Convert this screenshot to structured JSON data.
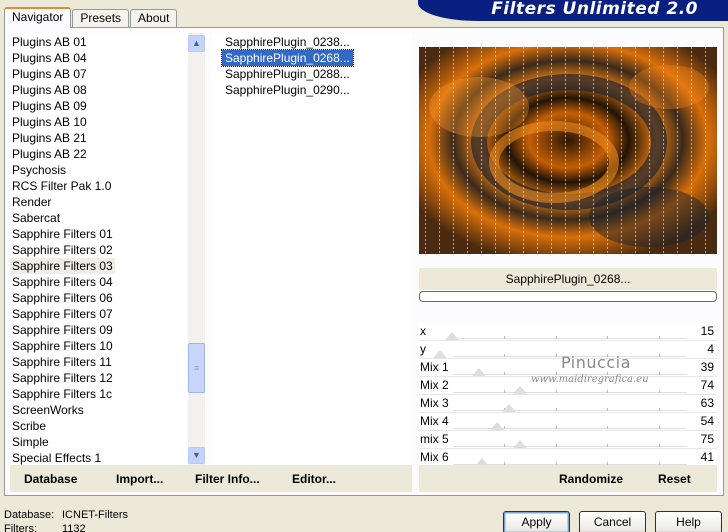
{
  "brand": {
    "title": "Filters Unlimited 2.0"
  },
  "tabs": [
    "Navigator",
    "Presets",
    "About"
  ],
  "categories": [
    "Plugins AB 01",
    "Plugins AB 04",
    "Plugins AB 07",
    "Plugins AB 08",
    "Plugins AB 09",
    "Plugins AB 10",
    "Plugins AB 21",
    "Plugins AB 22",
    "Psychosis",
    "RCS Filter Pak 1.0",
    "Render",
    "Sabercat",
    "Sapphire Filters 01",
    "Sapphire Filters 02",
    "Sapphire Filters 03",
    "Sapphire Filters 04",
    "Sapphire Filters 06",
    "Sapphire Filters 07",
    "Sapphire Filters 09",
    "Sapphire Filters 10",
    "Sapphire Filters 11",
    "Sapphire Filters 12",
    "Sapphire Filters 1c",
    "ScreenWorks",
    "Scribe",
    "Simple",
    "Special Effects 1"
  ],
  "selected_category_index": 14,
  "filters": [
    "SapphirePlugin_0238...",
    "SapphirePlugin_0268...",
    "SapphirePlugin_0288...",
    "SapphirePlugin_0290..."
  ],
  "selected_filter_index": 1,
  "db_buttons": {
    "database": "Database",
    "import": "Import...",
    "filter_info": "Filter Info...",
    "editor": "Editor..."
  },
  "preview": {
    "filter_name": "SapphirePlugin_0268..."
  },
  "controls": [
    {
      "label": "x",
      "value": "15",
      "level": 0.06
    },
    {
      "label": "y",
      "value": "4",
      "level": 0.02
    },
    {
      "label": "Mix 1",
      "value": "39",
      "level": 0.15
    },
    {
      "label": "Mix 2",
      "value": "74",
      "level": 0.29
    },
    {
      "label": "Mix 3",
      "value": "63",
      "level": 0.25
    },
    {
      "label": "Mix 4",
      "value": "54",
      "level": 0.21
    },
    {
      "label": "mix 5",
      "value": "75",
      "level": 0.29
    },
    {
      "label": "Mix 6",
      "value": "41",
      "level": 0.16
    }
  ],
  "watermark": {
    "name": "Pinuccia",
    "site": "www.maidiregrafica.eu"
  },
  "right_buttons": {
    "randomize": "Randomize",
    "reset": "Reset"
  },
  "status": {
    "database_key": "Database:",
    "database_val": "ICNET-Filters",
    "filters_key": "Filters:",
    "filters_val": "1132"
  },
  "dialog_buttons": {
    "apply": "Apply",
    "cancel": "Cancel",
    "help": "Help"
  },
  "colors": {
    "brand_bg": "#0a2080",
    "selection": "#316ac5",
    "tab_accent": "#e68b2c"
  }
}
